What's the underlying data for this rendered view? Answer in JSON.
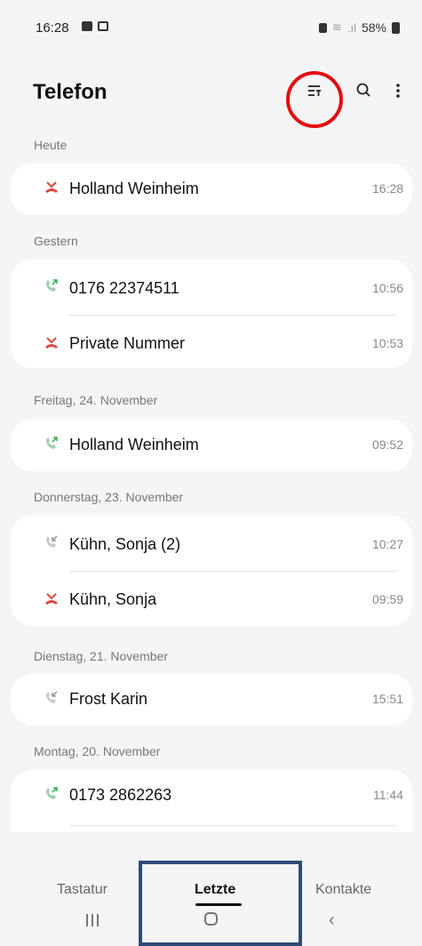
{
  "status_bar": {
    "time": "16:28",
    "battery": "58%"
  },
  "header": {
    "title": "Telefon"
  },
  "sections": [
    {
      "label": "Heute",
      "calls": [
        {
          "name": "Holland  Weinheim",
          "time": "16:28",
          "type": "missed"
        }
      ]
    },
    {
      "label": "Gestern",
      "calls": [
        {
          "name": "0176 22374511",
          "time": "10:56",
          "type": "outgoing"
        },
        {
          "name": "Private Nummer",
          "time": "10:53",
          "type": "missed"
        }
      ]
    },
    {
      "label": "Freitag, 24. November",
      "calls": [
        {
          "name": "Holland  Weinheim",
          "time": "09:52",
          "type": "outgoing"
        }
      ]
    },
    {
      "label": "Donnerstag, 23. November",
      "calls": [
        {
          "name": "Kühn, Sonja (2)",
          "time": "10:27",
          "type": "incoming"
        },
        {
          "name": "Kühn, Sonja",
          "time": "09:59",
          "type": "missed"
        }
      ]
    },
    {
      "label": "Dienstag, 21. November",
      "calls": [
        {
          "name": "Frost Karin",
          "time": "15:51",
          "type": "incoming"
        }
      ]
    },
    {
      "label": "Montag, 20. November",
      "calls": [
        {
          "name": "0173 2862263",
          "time": "11:44",
          "type": "outgoing"
        }
      ]
    }
  ],
  "bottom_tabs": {
    "keypad": "Tastatur",
    "recents": "Letzte",
    "contacts": "Kontakte"
  },
  "colors": {
    "missed": "#e0443c",
    "outgoing": "#3cab5f",
    "incoming": "#9a9a9a",
    "highlight_circle": "#e10e0e",
    "highlight_box": "#2f4a78"
  }
}
